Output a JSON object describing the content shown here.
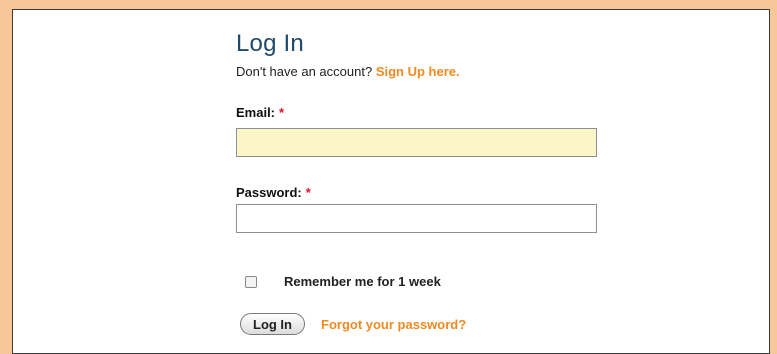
{
  "login": {
    "title": "Log In",
    "signup_prompt": "Don't have an account?",
    "signup_link": "Sign Up here.",
    "email_label": "Email:",
    "password_label": "Password:",
    "required_marker": "*",
    "email_value": "",
    "password_value": "",
    "remember_label": "Remember me for 1 week",
    "remember_checked": false,
    "login_button": "Log In",
    "forgot_link": "Forgot your password?"
  },
  "colors": {
    "page_background": "#f7c79a",
    "title": "#1f4a6b",
    "link": "#f08a22",
    "required": "#e8102a",
    "email_field_background": "#fbf6c8"
  }
}
